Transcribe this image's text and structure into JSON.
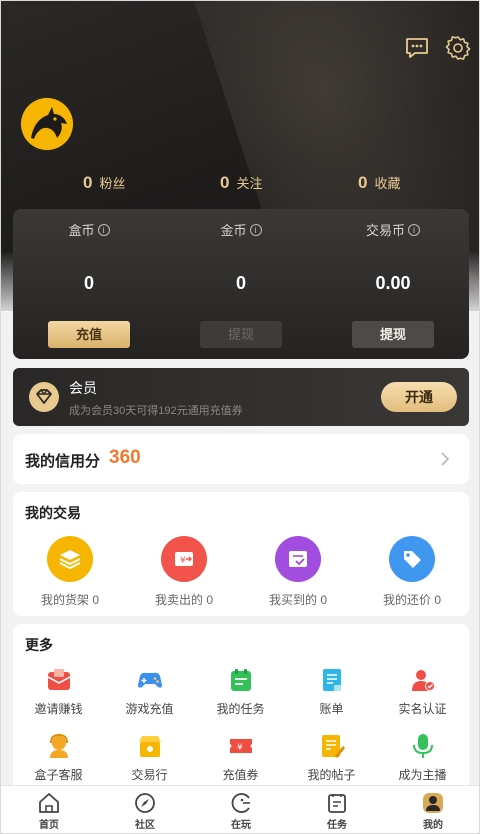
{
  "header": {
    "icons": [
      "chat-icon",
      "gear-icon"
    ],
    "avatar": "dragon-avatar"
  },
  "stats": [
    {
      "value": "0",
      "label": "粉丝"
    },
    {
      "value": "0",
      "label": "关注"
    },
    {
      "value": "0",
      "label": "收藏"
    }
  ],
  "wallet": [
    {
      "label": "盒币",
      "value": "0",
      "button": "充值"
    },
    {
      "label": "金币",
      "value": "0",
      "button": "提现"
    },
    {
      "label": "交易币",
      "value": "0.00",
      "button": "提现"
    }
  ],
  "vip": {
    "title": "会员",
    "desc": "成为会员30天可得192元通用充值券",
    "button": "开通"
  },
  "credit": {
    "label": "我的信用分",
    "score": "360"
  },
  "trade": {
    "title": "我的交易",
    "items": [
      {
        "label": "我的货架 0",
        "icon": "stack-icon",
        "color": "#f5b500"
      },
      {
        "label": "我卖出的 0",
        "icon": "sold-icon",
        "color": "#f2534a"
      },
      {
        "label": "我买到的 0",
        "icon": "bought-icon",
        "color": "#a24ce0"
      },
      {
        "label": "我的还价 0",
        "icon": "tag-icon",
        "color": "#3f97f0"
      }
    ]
  },
  "more": {
    "title": "更多",
    "items": [
      {
        "label": "邀请赚钱",
        "icon": "invite-icon"
      },
      {
        "label": "游戏充值",
        "icon": "gamepad-icon"
      },
      {
        "label": "我的任务",
        "icon": "task-icon"
      },
      {
        "label": "账单",
        "icon": "bill-icon"
      },
      {
        "label": "实名认证",
        "icon": "verify-icon"
      },
      {
        "label": "盒子客服",
        "icon": "service-icon"
      },
      {
        "label": "交易行",
        "icon": "shop-icon"
      },
      {
        "label": "充值券",
        "icon": "coupon-icon"
      },
      {
        "label": "我的帖子",
        "icon": "post-icon"
      },
      {
        "label": "成为主播",
        "icon": "mic-icon"
      }
    ]
  },
  "tabs": [
    {
      "label": "首页",
      "icon": "home-icon"
    },
    {
      "label": "社区",
      "icon": "compass-icon"
    },
    {
      "label": "在玩",
      "icon": "play-icon"
    },
    {
      "label": "任务",
      "icon": "clipboard-icon"
    },
    {
      "label": "我的",
      "icon": "profile-icon"
    }
  ],
  "colors": {
    "gold": "#e8c98e",
    "score": "#f07a2c"
  }
}
